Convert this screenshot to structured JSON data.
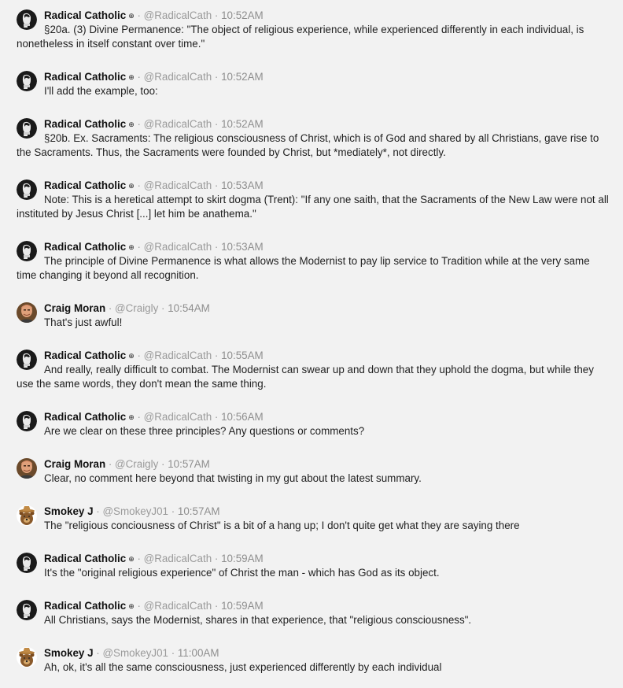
{
  "colors": {
    "background": "#f2f2f2",
    "name": "#111111",
    "meta": "#9a9a9a",
    "text": "#1f1f1f"
  },
  "messages": [
    {
      "user": "Radical Catholic",
      "badge": "⊕",
      "handle": "@RadicalCath",
      "sep": "·",
      "time": "10:52AM",
      "avatar": "radical-catholic-avatar",
      "text": "§20a. (3) Divine Permanence: \"The object of religious experience, while experienced differently in each individual, is nonetheless in itself constant over time.\""
    },
    {
      "user": "Radical Catholic",
      "badge": "⊕",
      "handle": "@RadicalCath",
      "sep": "·",
      "time": "10:52AM",
      "avatar": "radical-catholic-avatar",
      "text": "I'll add the example, too:"
    },
    {
      "user": "Radical Catholic",
      "badge": "⊕",
      "handle": "@RadicalCath",
      "sep": "·",
      "time": "10:52AM",
      "avatar": "radical-catholic-avatar",
      "text": "§20b. Ex. Sacraments: The religious consciousness of Christ, which is of God and shared by all Christians, gave rise to the Sacraments. Thus, the Sacraments were founded by Christ, but *mediately*, not directly."
    },
    {
      "user": "Radical Catholic",
      "badge": "⊕",
      "handle": "@RadicalCath",
      "sep": "·",
      "time": "10:53AM",
      "avatar": "radical-catholic-avatar",
      "text": "Note: This is a heretical attempt to skirt dogma (Trent): \"If any one saith, that the Sacraments of the New Law were not all instituted by Jesus Christ [...] let him be anathema.\""
    },
    {
      "user": "Radical Catholic",
      "badge": "⊕",
      "handle": "@RadicalCath",
      "sep": "·",
      "time": "10:53AM",
      "avatar": "radical-catholic-avatar",
      "text": "The principle of Divine Permanence is what allows the Modernist to pay lip service to Tradition while at the very same time changing it beyond all recognition."
    },
    {
      "user": "Craig Moran",
      "badge": "",
      "handle": "@Craigly",
      "sep": "·",
      "time": "10:54AM",
      "avatar": "craig-moran-avatar",
      "text": "That's just awful!"
    },
    {
      "user": "Radical Catholic",
      "badge": "⊕",
      "handle": "@RadicalCath",
      "sep": "·",
      "time": "10:55AM",
      "avatar": "radical-catholic-avatar",
      "text": "And really, really difficult to combat. The Modernist can swear up and down that they uphold the dogma, but while they use the same words, they don't mean the same thing."
    },
    {
      "user": "Radical Catholic",
      "badge": "⊕",
      "handle": "@RadicalCath",
      "sep": "·",
      "time": "10:56AM",
      "avatar": "radical-catholic-avatar",
      "text": "Are we clear on these three principles? Any questions or comments?"
    },
    {
      "user": "Craig Moran",
      "badge": "",
      "handle": "@Craigly",
      "sep": "·",
      "time": "10:57AM",
      "avatar": "craig-moran-avatar",
      "text": "Clear, no comment here beyond that twisting in my gut about the latest summary."
    },
    {
      "user": "Smokey J",
      "badge": "",
      "handle": "@SmokeyJ01",
      "sep": "·",
      "time": "10:57AM",
      "avatar": "smokey-bear-avatar",
      "text": "The \"religious conciousness of Christ\" is a bit of a hang up; I don't quite get what they are saying there"
    },
    {
      "user": "Radical Catholic",
      "badge": "⊕",
      "handle": "@RadicalCath",
      "sep": "·",
      "time": "10:59AM",
      "avatar": "radical-catholic-avatar",
      "text": "It's the \"original religious experience\" of Christ the man - which has God as its object."
    },
    {
      "user": "Radical Catholic",
      "badge": "⊕",
      "handle": "@RadicalCath",
      "sep": "·",
      "time": "10:59AM",
      "avatar": "radical-catholic-avatar",
      "text": "All Christians, says the Modernist, shares in that experience, that \"religious consciousness\"."
    },
    {
      "user": "Smokey J",
      "badge": "",
      "handle": "@SmokeyJ01",
      "sep": "·",
      "time": "11:00AM",
      "avatar": "smokey-bear-avatar",
      "text": "Ah, ok, it's all the same consciousness, just experienced differently by each individual"
    }
  ]
}
